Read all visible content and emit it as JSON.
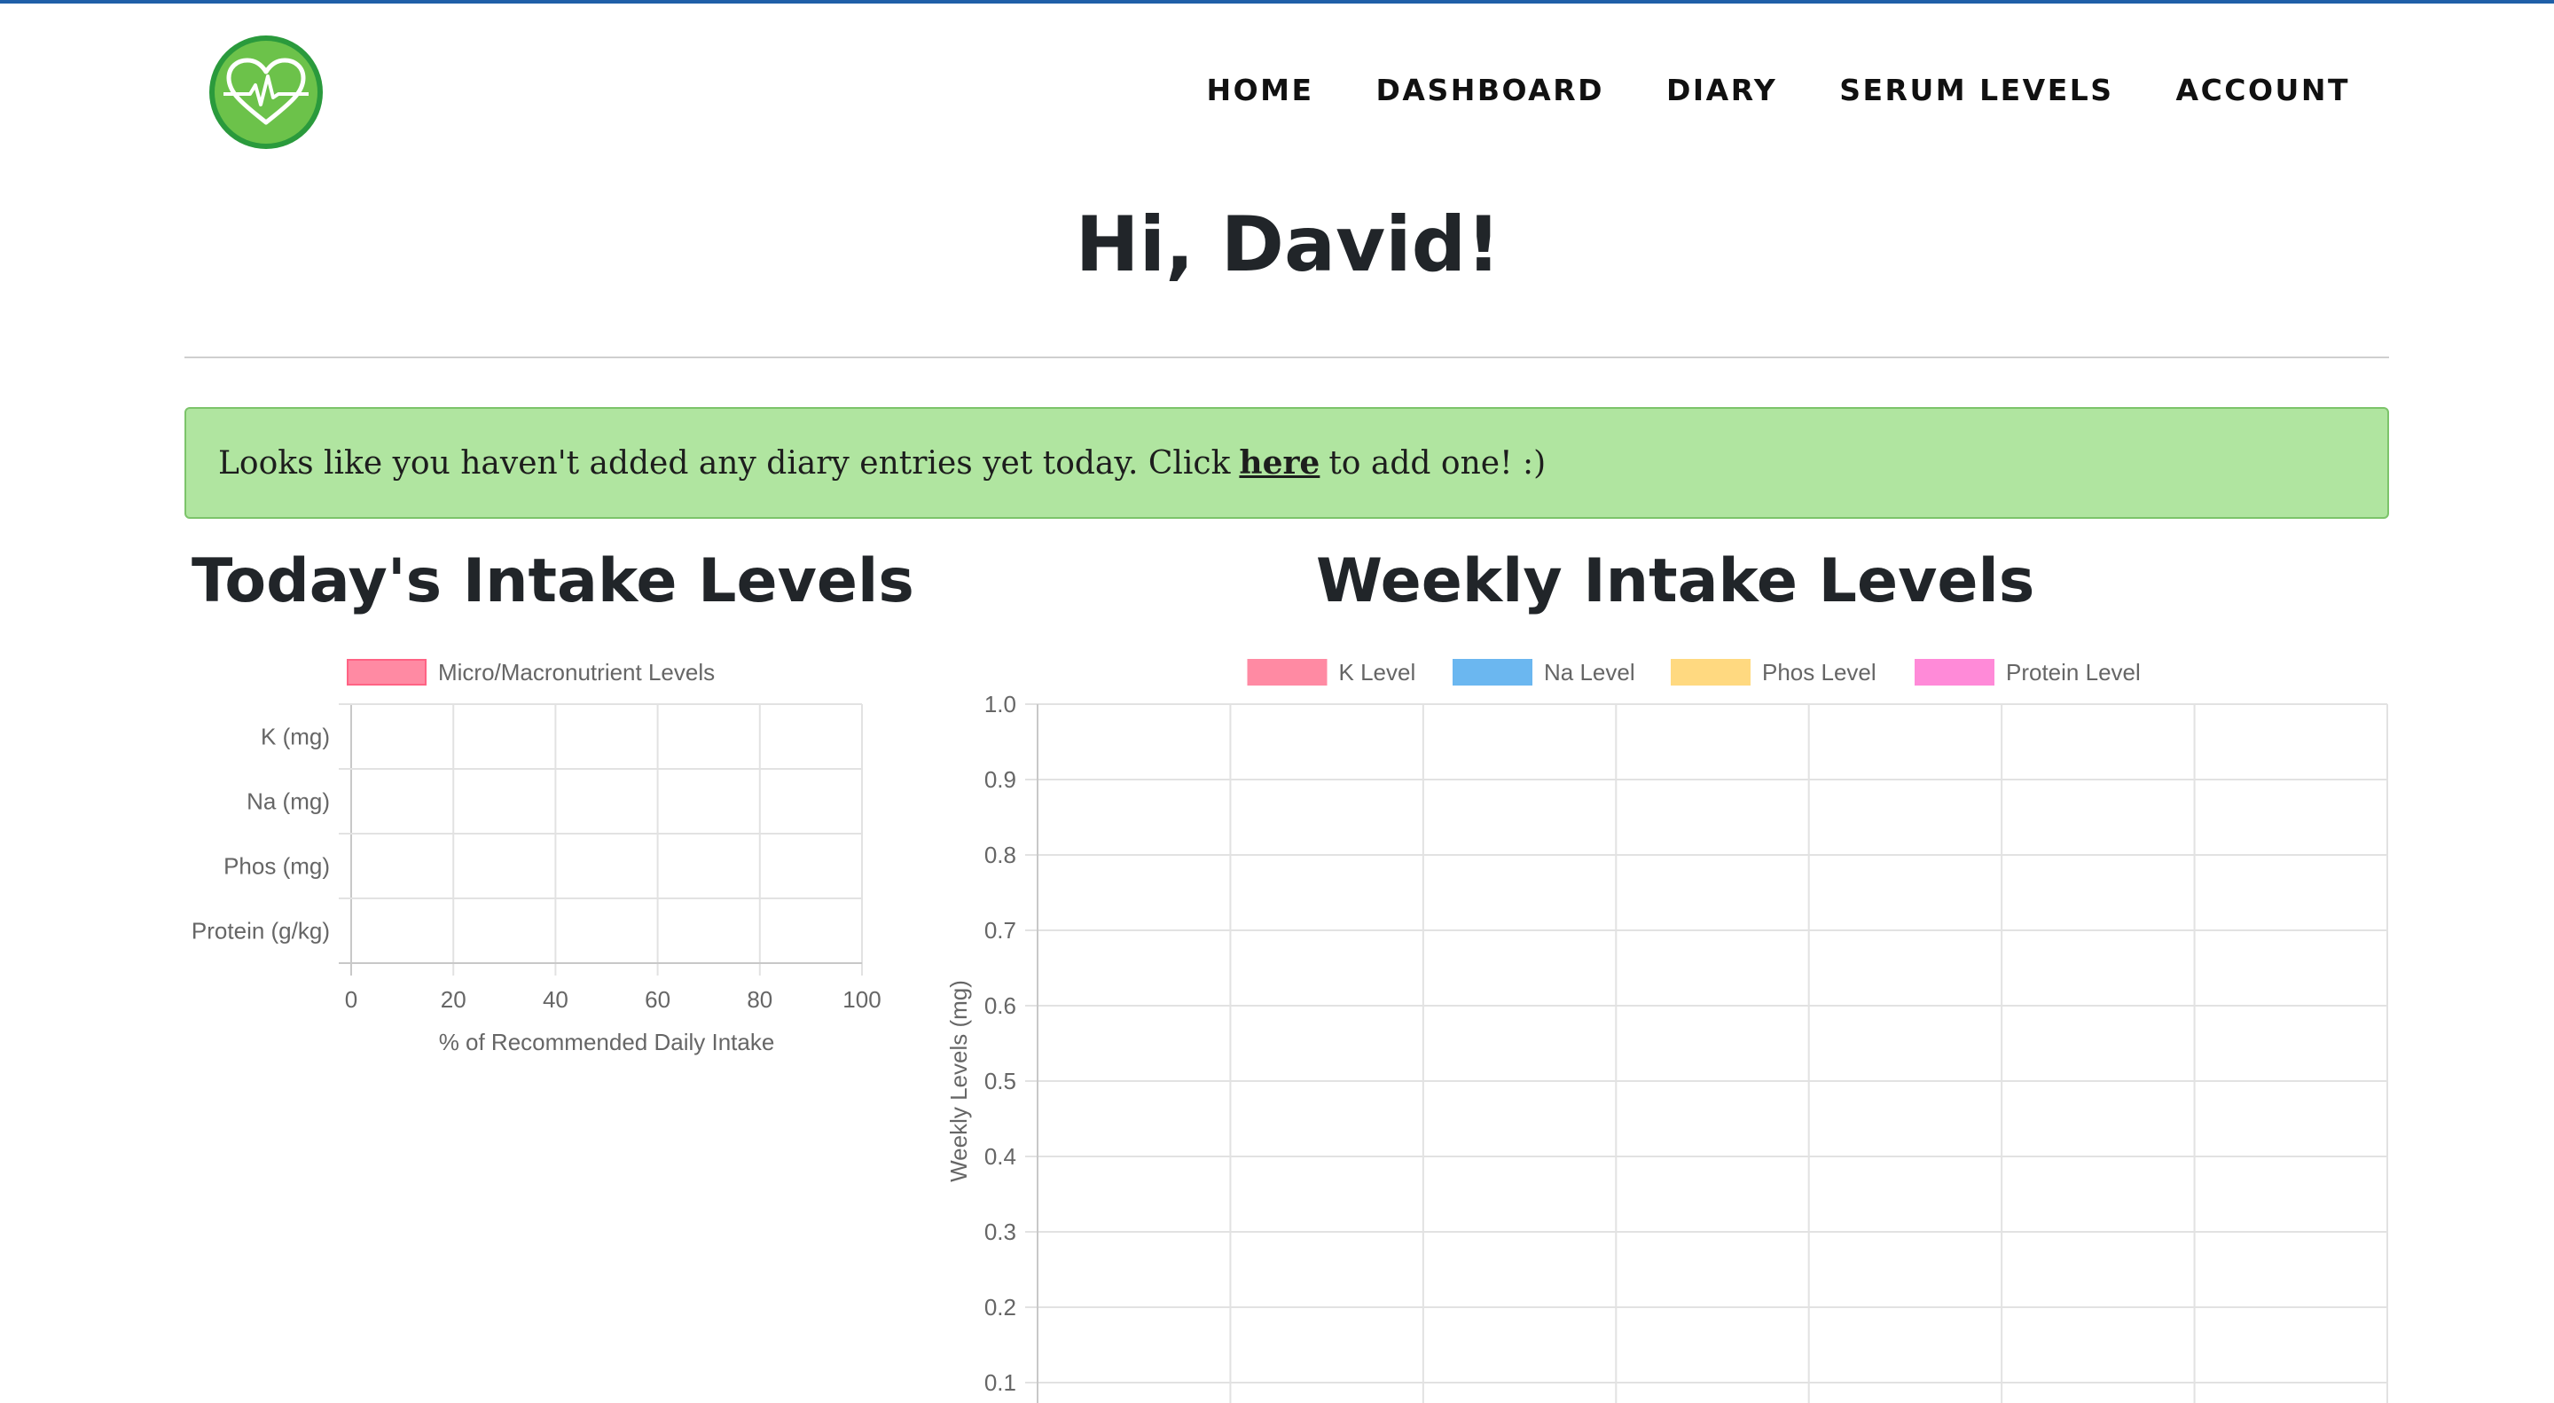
{
  "nav": {
    "home": "HOME",
    "dashboard": "DASHBOARD",
    "diary": "DIARY",
    "serum_levels": "SERUM LEVELS",
    "account": "ACCOUNT"
  },
  "logo": {
    "icon": "heart-pulse-icon"
  },
  "greeting": "Hi, David!",
  "alert": {
    "before": "Looks like you haven't added any diary entries yet today. Click",
    "link": "here",
    "after": "to add one! :)"
  },
  "colors": {
    "accent": "#1f5fa8",
    "alert_bg": "#b0e5a0",
    "alert_border": "#7cc46a",
    "logo_outer": "#2a9a3c",
    "logo_inner": "#6cc24a"
  },
  "today": {
    "title": "Today's Intake Levels"
  },
  "weekly": {
    "title": "Weekly Intake Levels"
  },
  "chart_data": [
    {
      "type": "bar",
      "orientation": "horizontal",
      "title": "",
      "categories": [
        "K (mg)",
        "Na (mg)",
        "Phos (mg)",
        "Protein (g/kg)"
      ],
      "series": [
        {
          "name": "Micro/Macronutrient Levels",
          "color": "#ff8aa3",
          "values": [
            null,
            null,
            null,
            null
          ]
        }
      ],
      "xlabel": "% of Recommended Daily Intake",
      "ylabel": "",
      "xlim": [
        0,
        100
      ],
      "xticks": [
        "0",
        "20",
        "40",
        "60",
        "80",
        "100"
      ],
      "grid": true,
      "legend": "top"
    },
    {
      "type": "line",
      "title": "",
      "categories": [
        "",
        "",
        "",
        "",
        "",
        "",
        "",
        ""
      ],
      "series": [
        {
          "name": "K Level",
          "color": "#ff8aa3",
          "values": []
        },
        {
          "name": "Na Level",
          "color": "#6bb7f0",
          "values": []
        },
        {
          "name": "Phos Level",
          "color": "#ffd980",
          "values": []
        },
        {
          "name": "Protein Level",
          "color": "#ff8ad8",
          "values": []
        }
      ],
      "xlabel": "",
      "ylabel": "Weekly Levels (mg)",
      "ylim": [
        0,
        1
      ],
      "yticks": [
        "1.0",
        "0.9",
        "0.8",
        "0.7",
        "0.6",
        "0.5",
        "0.4",
        "0.3",
        "0.2",
        "0.1"
      ],
      "grid": true,
      "legend": "top"
    }
  ]
}
